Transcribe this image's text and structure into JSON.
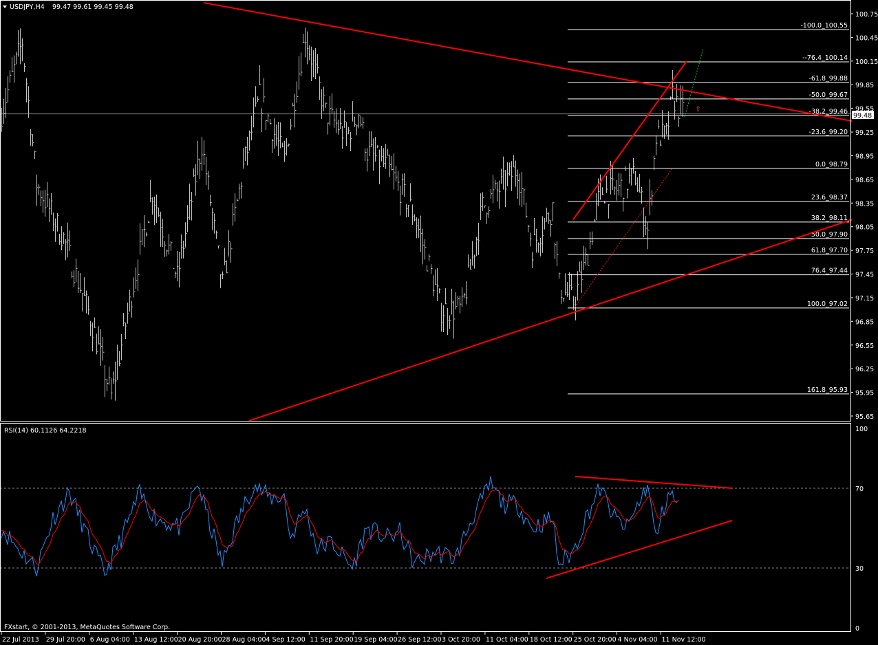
{
  "header": {
    "symbol": "USDJPY,H4",
    "ohlc": "99.47 99.61 99.45 99.48"
  },
  "rsi_header": "RSI(14) 60.1126 64.2218",
  "footer": "FXstart, © 2001-2013, MetaQuotes Software Corp.",
  "current_price": "99.48",
  "colors": {
    "bg": "#000000",
    "bars": "#c0c0c0",
    "trend": "#ff0000",
    "rsi": "#1e90ff",
    "signal": "#ff0000",
    "projection": "#00cc00"
  },
  "chart_data": [
    {
      "type": "line",
      "title": "USDJPY,H4",
      "ylim": [
        95.65,
        100.75
      ],
      "yticks": [
        "100.75",
        "100.45",
        "100.15",
        "99.85",
        "99.55",
        "99.25",
        "98.95",
        "98.65",
        "98.35",
        "98.05",
        "97.75",
        "97.45",
        "97.15",
        "96.85",
        "96.55",
        "96.25",
        "95.95",
        "95.65"
      ],
      "xticks": [
        "22 Jul 2013",
        "29 Jul 20:00",
        "6 Aug 04:00",
        "13 Aug 12:00",
        "20 Aug 20:00",
        "28 Aug 04:00",
        "4 Sep 12:00",
        "11 Sep 20:00",
        "19 Sep 04:00",
        "26 Sep 12:00",
        "3 Oct 20:00",
        "11 Oct 04:00",
        "18 Oct 12:00",
        "25 Oct 20:00",
        "4 Nov 04:00",
        "11 Nov 12:00"
      ],
      "bar_range": [
        0,
        412
      ],
      "close_path": [
        [
          0,
          99.5
        ],
        [
          10,
          100.4
        ],
        [
          17,
          98.6
        ],
        [
          30,
          97.9
        ],
        [
          43,
          96.9
        ],
        [
          53,
          95.9
        ],
        [
          63,
          97.2
        ],
        [
          73,
          98.5
        ],
        [
          85,
          97.4
        ],
        [
          97,
          99.1
        ],
        [
          107,
          97.3
        ],
        [
          117,
          98.8
        ],
        [
          125,
          99.7
        ],
        [
          137,
          98.9
        ],
        [
          147,
          100.5
        ],
        [
          157,
          99.5
        ],
        [
          167,
          99.2
        ],
        [
          173,
          99.5
        ],
        [
          177,
          99.0
        ],
        [
          187,
          98.8
        ],
        [
          200,
          98.2
        ],
        [
          213,
          97.0
        ],
        [
          223,
          97.0
        ],
        [
          233,
          98.3
        ],
        [
          240,
          98.5
        ],
        [
          250,
          98.8
        ],
        [
          257,
          97.8
        ],
        [
          267,
          98.3
        ],
        [
          270,
          97.3
        ],
        [
          277,
          97.1
        ],
        [
          283,
          97.6
        ],
        [
          290,
          98.5
        ],
        [
          297,
          98.5
        ],
        [
          307,
          98.7
        ],
        [
          313,
          98.0
        ],
        [
          317,
          99.2
        ],
        [
          322,
          99.2
        ],
        [
          325,
          99.7
        ],
        [
          330,
          99.48
        ]
      ],
      "fibonacci": [
        [
          "-100.0",
          "100.55"
        ],
        [
          "--76.4",
          "100.14"
        ],
        [
          "-61.8",
          "99.88"
        ],
        [
          "-50.0",
          "99.67"
        ],
        [
          "-38.2",
          "99.46"
        ],
        [
          "-23.6",
          "99.20"
        ],
        [
          "0.0",
          "98.79"
        ],
        [
          "23.6",
          "98.37"
        ],
        [
          "38.2",
          "98.11"
        ],
        [
          "50.0",
          "97.90"
        ],
        [
          "61.8",
          "97.70"
        ],
        [
          "76.4",
          "97.44"
        ],
        [
          "100.0",
          "97.02"
        ],
        [
          "161.8",
          "95.93"
        ]
      ],
      "trendlines": [
        {
          "name": "resistance",
          "from": [
            98,
            100.89
          ],
          "to": [
            412,
            99.39
          ],
          "style": "solid"
        },
        {
          "name": "support",
          "from": [
            120,
            95.59
          ],
          "to": [
            412,
            98.14
          ],
          "style": "solid"
        },
        {
          "name": "channel-upper",
          "from": [
            277,
            98.14
          ],
          "to": [
            332,
            100.15
          ],
          "style": "solid"
        },
        {
          "name": "channel-lower",
          "from": [
            277,
            97.0
          ],
          "to": [
            325,
            98.79
          ],
          "style": "dotted"
        },
        {
          "name": "projection",
          "from": [
            331,
            99.44
          ],
          "to": [
            340,
            100.31
          ],
          "style": "dotted-green"
        }
      ]
    },
    {
      "type": "line",
      "title": "RSI(14)",
      "ylim": [
        0,
        100
      ],
      "yticks": [
        "100",
        "70",
        "30",
        "0"
      ],
      "levels": [
        70,
        30
      ],
      "rsi_path": [
        [
          0,
          50
        ],
        [
          8,
          40
        ],
        [
          17,
          30
        ],
        [
          25,
          55
        ],
        [
          33,
          68
        ],
        [
          42,
          45
        ],
        [
          50,
          27
        ],
        [
          58,
          45
        ],
        [
          67,
          67
        ],
        [
          75,
          55
        ],
        [
          87,
          50
        ],
        [
          95,
          73
        ],
        [
          100,
          55
        ],
        [
          107,
          32
        ],
        [
          113,
          50
        ],
        [
          122,
          72
        ],
        [
          130,
          65
        ],
        [
          137,
          66
        ],
        [
          140,
          45
        ],
        [
          147,
          60
        ],
        [
          153,
          40
        ],
        [
          160,
          43
        ],
        [
          170,
          30
        ],
        [
          177,
          50
        ],
        [
          187,
          45
        ],
        [
          193,
          48
        ],
        [
          200,
          32
        ],
        [
          210,
          38
        ],
        [
          220,
          35
        ],
        [
          228,
          55
        ],
        [
          237,
          72
        ],
        [
          243,
          62
        ],
        [
          250,
          62
        ],
        [
          257,
          50
        ],
        [
          267,
          55
        ],
        [
          270,
          32
        ],
        [
          277,
          38
        ],
        [
          283,
          55
        ],
        [
          290,
          70
        ],
        [
          297,
          55
        ],
        [
          303,
          50
        ],
        [
          313,
          72
        ],
        [
          317,
          45
        ],
        [
          323,
          68
        ],
        [
          328,
          62
        ]
      ],
      "trendlines": [
        {
          "from": [
            278,
            75.9
          ],
          "to": [
            354,
            70
          ]
        },
        {
          "from": [
            264,
            24.8
          ],
          "to": [
            354,
            53.8
          ]
        }
      ]
    }
  ]
}
